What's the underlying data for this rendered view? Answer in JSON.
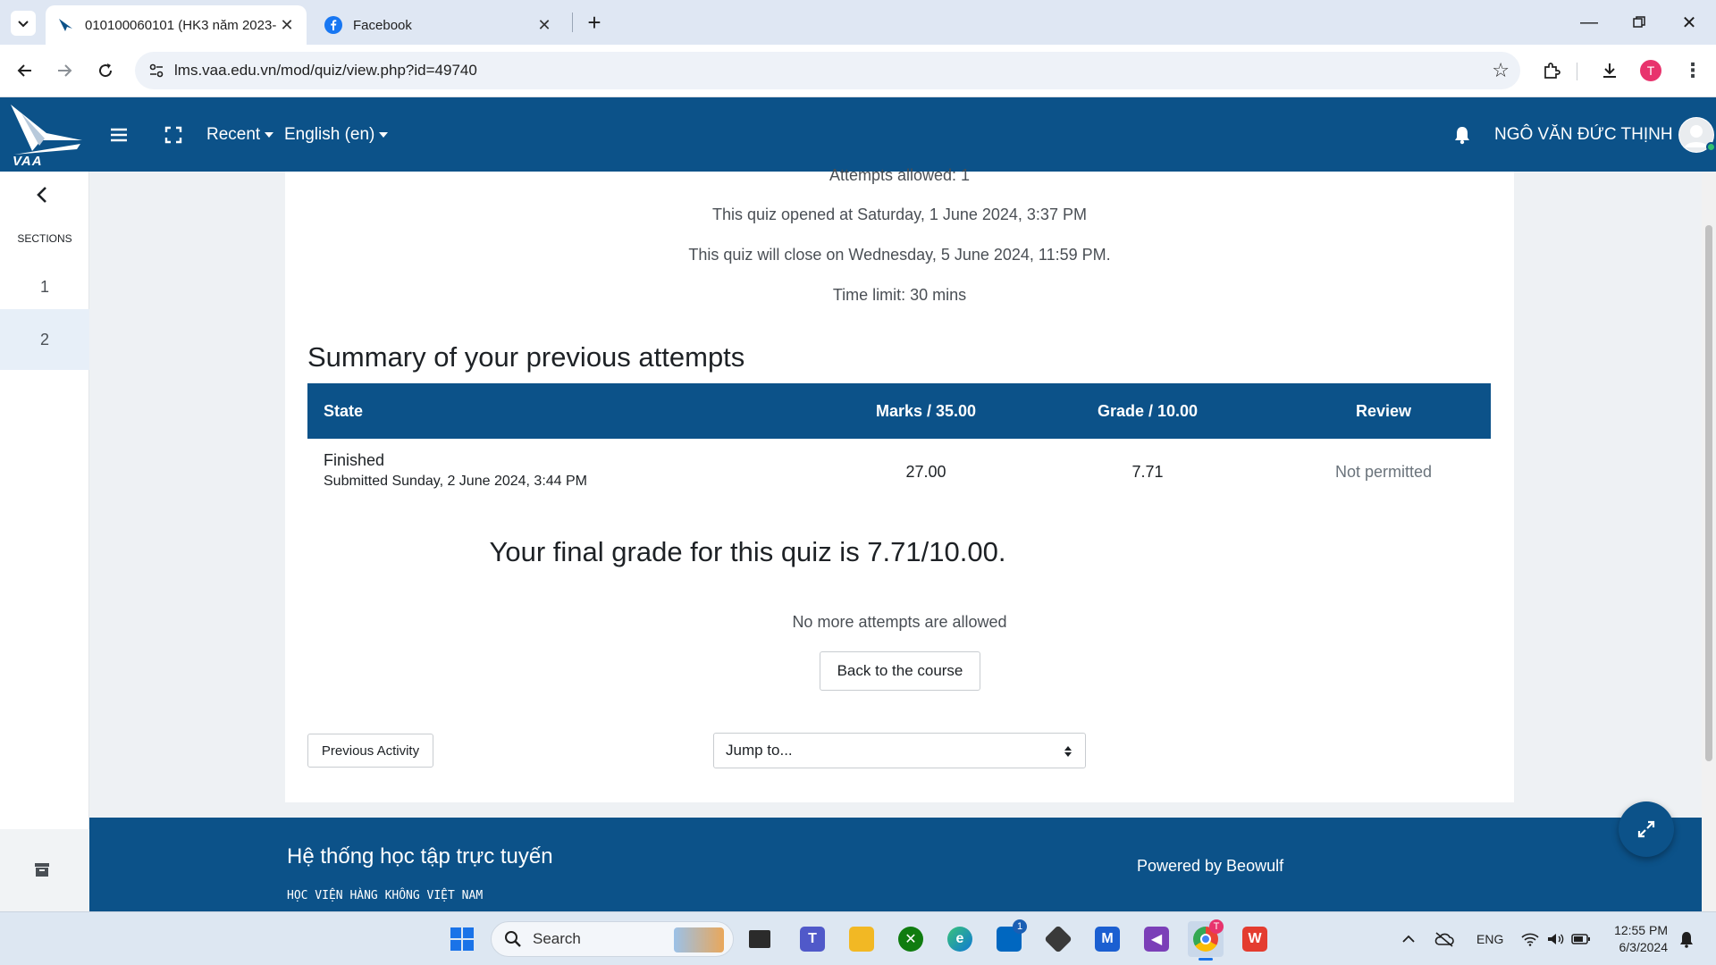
{
  "browser": {
    "tabs": [
      {
        "title": "010100060101 (HK3 năm 2023-",
        "active": true
      },
      {
        "title": "Facebook",
        "active": false
      }
    ],
    "url": "lms.vaa.edu.vn/mod/quiz/view.php?id=49740",
    "profile_initial": "T"
  },
  "navbar": {
    "logo_text": "VAA",
    "recent_label": "Recent",
    "language_label": "English (en)",
    "user_name": "NGÔ VĂN ĐỨC THỊNH"
  },
  "drawer": {
    "sections_label": "SECTIONS",
    "sections": [
      "1",
      "2"
    ]
  },
  "quiz": {
    "attempts_allowed": "Attempts allowed: 1",
    "opened": "This quiz opened at Saturday, 1 June 2024, 3:37 PM",
    "closes": "This quiz will close on Wednesday, 5 June 2024, 11:59 PM.",
    "time_limit": "Time limit: 30 mins",
    "summary_heading": "Summary of your previous attempts",
    "table": {
      "headers": [
        "State",
        "Marks / 35.00",
        "Grade / 10.00",
        "Review"
      ],
      "rows": [
        {
          "state": "Finished",
          "submitted": "Submitted Sunday, 2 June 2024, 3:44 PM",
          "marks": "27.00",
          "grade": "7.71",
          "review": "Not permitted"
        }
      ]
    },
    "final_grade": "Your final grade for this quiz is 7.71/10.00.",
    "no_more_attempts": "No more attempts are allowed",
    "back_button": "Back to the course",
    "previous_activity": "Previous Activity",
    "jump_to": "Jump to..."
  },
  "footer": {
    "title": "Hệ thống học tập trực tuyến",
    "subtitle": "HỌC VIỆN HÀNG KHÔNG VIỆT NAM",
    "powered": "Powered by Beowulf"
  },
  "taskbar": {
    "search_placeholder": "Search",
    "language": "ENG",
    "time": "12:55 PM",
    "date": "6/3/2024",
    "store_badge": "1",
    "chrome_badge": "T"
  },
  "colors": {
    "brand": "#0c5289",
    "browser_tabstrip": "#dfe7f3",
    "page_bg": "#eef1f4"
  }
}
